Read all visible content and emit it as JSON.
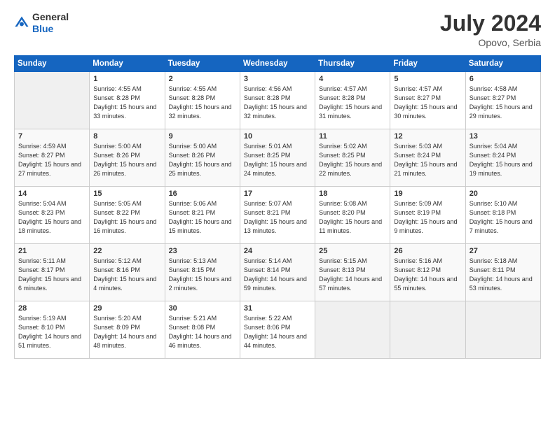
{
  "logo": {
    "general": "General",
    "blue": "Blue"
  },
  "header": {
    "month_year": "July 2024",
    "location": "Opovo, Serbia"
  },
  "days_of_week": [
    "Sunday",
    "Monday",
    "Tuesday",
    "Wednesday",
    "Thursday",
    "Friday",
    "Saturday"
  ],
  "weeks": [
    [
      {
        "day": "",
        "sunrise": "",
        "sunset": "",
        "daylight": ""
      },
      {
        "day": "1",
        "sunrise": "Sunrise: 4:55 AM",
        "sunset": "Sunset: 8:28 PM",
        "daylight": "Daylight: 15 hours and 33 minutes."
      },
      {
        "day": "2",
        "sunrise": "Sunrise: 4:55 AM",
        "sunset": "Sunset: 8:28 PM",
        "daylight": "Daylight: 15 hours and 32 minutes."
      },
      {
        "day": "3",
        "sunrise": "Sunrise: 4:56 AM",
        "sunset": "Sunset: 8:28 PM",
        "daylight": "Daylight: 15 hours and 32 minutes."
      },
      {
        "day": "4",
        "sunrise": "Sunrise: 4:57 AM",
        "sunset": "Sunset: 8:28 PM",
        "daylight": "Daylight: 15 hours and 31 minutes."
      },
      {
        "day": "5",
        "sunrise": "Sunrise: 4:57 AM",
        "sunset": "Sunset: 8:27 PM",
        "daylight": "Daylight: 15 hours and 30 minutes."
      },
      {
        "day": "6",
        "sunrise": "Sunrise: 4:58 AM",
        "sunset": "Sunset: 8:27 PM",
        "daylight": "Daylight: 15 hours and 29 minutes."
      }
    ],
    [
      {
        "day": "7",
        "sunrise": "Sunrise: 4:59 AM",
        "sunset": "Sunset: 8:27 PM",
        "daylight": "Daylight: 15 hours and 27 minutes."
      },
      {
        "day": "8",
        "sunrise": "Sunrise: 5:00 AM",
        "sunset": "Sunset: 8:26 PM",
        "daylight": "Daylight: 15 hours and 26 minutes."
      },
      {
        "day": "9",
        "sunrise": "Sunrise: 5:00 AM",
        "sunset": "Sunset: 8:26 PM",
        "daylight": "Daylight: 15 hours and 25 minutes."
      },
      {
        "day": "10",
        "sunrise": "Sunrise: 5:01 AM",
        "sunset": "Sunset: 8:25 PM",
        "daylight": "Daylight: 15 hours and 24 minutes."
      },
      {
        "day": "11",
        "sunrise": "Sunrise: 5:02 AM",
        "sunset": "Sunset: 8:25 PM",
        "daylight": "Daylight: 15 hours and 22 minutes."
      },
      {
        "day": "12",
        "sunrise": "Sunrise: 5:03 AM",
        "sunset": "Sunset: 8:24 PM",
        "daylight": "Daylight: 15 hours and 21 minutes."
      },
      {
        "day": "13",
        "sunrise": "Sunrise: 5:04 AM",
        "sunset": "Sunset: 8:24 PM",
        "daylight": "Daylight: 15 hours and 19 minutes."
      }
    ],
    [
      {
        "day": "14",
        "sunrise": "Sunrise: 5:04 AM",
        "sunset": "Sunset: 8:23 PM",
        "daylight": "Daylight: 15 hours and 18 minutes."
      },
      {
        "day": "15",
        "sunrise": "Sunrise: 5:05 AM",
        "sunset": "Sunset: 8:22 PM",
        "daylight": "Daylight: 15 hours and 16 minutes."
      },
      {
        "day": "16",
        "sunrise": "Sunrise: 5:06 AM",
        "sunset": "Sunset: 8:21 PM",
        "daylight": "Daylight: 15 hours and 15 minutes."
      },
      {
        "day": "17",
        "sunrise": "Sunrise: 5:07 AM",
        "sunset": "Sunset: 8:21 PM",
        "daylight": "Daylight: 15 hours and 13 minutes."
      },
      {
        "day": "18",
        "sunrise": "Sunrise: 5:08 AM",
        "sunset": "Sunset: 8:20 PM",
        "daylight": "Daylight: 15 hours and 11 minutes."
      },
      {
        "day": "19",
        "sunrise": "Sunrise: 5:09 AM",
        "sunset": "Sunset: 8:19 PM",
        "daylight": "Daylight: 15 hours and 9 minutes."
      },
      {
        "day": "20",
        "sunrise": "Sunrise: 5:10 AM",
        "sunset": "Sunset: 8:18 PM",
        "daylight": "Daylight: 15 hours and 7 minutes."
      }
    ],
    [
      {
        "day": "21",
        "sunrise": "Sunrise: 5:11 AM",
        "sunset": "Sunset: 8:17 PM",
        "daylight": "Daylight: 15 hours and 6 minutes."
      },
      {
        "day": "22",
        "sunrise": "Sunrise: 5:12 AM",
        "sunset": "Sunset: 8:16 PM",
        "daylight": "Daylight: 15 hours and 4 minutes."
      },
      {
        "day": "23",
        "sunrise": "Sunrise: 5:13 AM",
        "sunset": "Sunset: 8:15 PM",
        "daylight": "Daylight: 15 hours and 2 minutes."
      },
      {
        "day": "24",
        "sunrise": "Sunrise: 5:14 AM",
        "sunset": "Sunset: 8:14 PM",
        "daylight": "Daylight: 14 hours and 59 minutes."
      },
      {
        "day": "25",
        "sunrise": "Sunrise: 5:15 AM",
        "sunset": "Sunset: 8:13 PM",
        "daylight": "Daylight: 14 hours and 57 minutes."
      },
      {
        "day": "26",
        "sunrise": "Sunrise: 5:16 AM",
        "sunset": "Sunset: 8:12 PM",
        "daylight": "Daylight: 14 hours and 55 minutes."
      },
      {
        "day": "27",
        "sunrise": "Sunrise: 5:18 AM",
        "sunset": "Sunset: 8:11 PM",
        "daylight": "Daylight: 14 hours and 53 minutes."
      }
    ],
    [
      {
        "day": "28",
        "sunrise": "Sunrise: 5:19 AM",
        "sunset": "Sunset: 8:10 PM",
        "daylight": "Daylight: 14 hours and 51 minutes."
      },
      {
        "day": "29",
        "sunrise": "Sunrise: 5:20 AM",
        "sunset": "Sunset: 8:09 PM",
        "daylight": "Daylight: 14 hours and 48 minutes."
      },
      {
        "day": "30",
        "sunrise": "Sunrise: 5:21 AM",
        "sunset": "Sunset: 8:08 PM",
        "daylight": "Daylight: 14 hours and 46 minutes."
      },
      {
        "day": "31",
        "sunrise": "Sunrise: 5:22 AM",
        "sunset": "Sunset: 8:06 PM",
        "daylight": "Daylight: 14 hours and 44 minutes."
      },
      {
        "day": "",
        "sunrise": "",
        "sunset": "",
        "daylight": ""
      },
      {
        "day": "",
        "sunrise": "",
        "sunset": "",
        "daylight": ""
      },
      {
        "day": "",
        "sunrise": "",
        "sunset": "",
        "daylight": ""
      }
    ]
  ]
}
